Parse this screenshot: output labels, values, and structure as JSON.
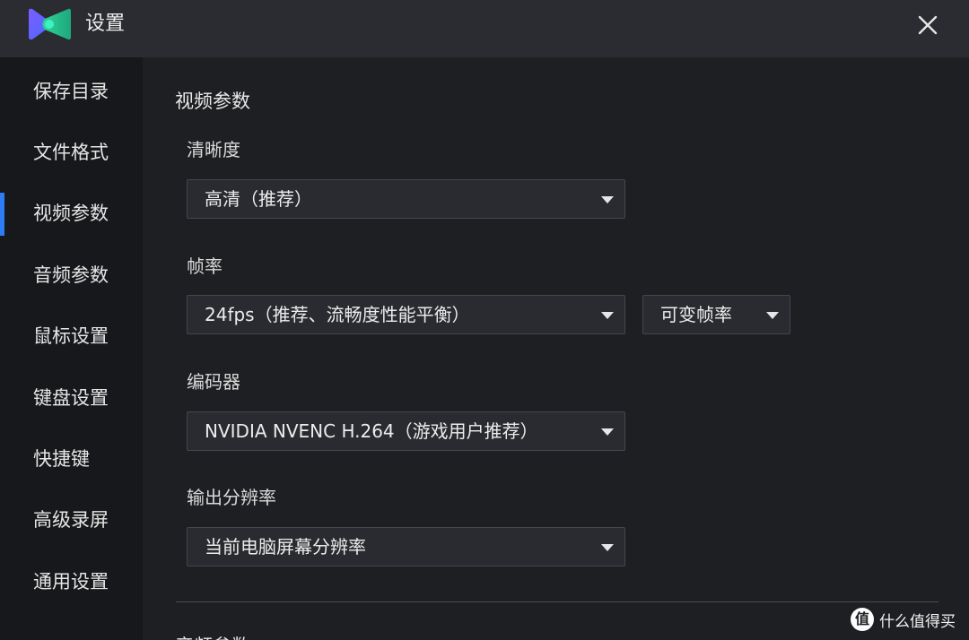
{
  "window": {
    "title": "设置",
    "close_icon": "close-icon"
  },
  "sidebar": {
    "items": [
      {
        "label": "保存目录",
        "active": false
      },
      {
        "label": "文件格式",
        "active": false
      },
      {
        "label": "视频参数",
        "active": true
      },
      {
        "label": "音频参数",
        "active": false
      },
      {
        "label": "鼠标设置",
        "active": false
      },
      {
        "label": "键盘设置",
        "active": false
      },
      {
        "label": "快捷键",
        "active": false
      },
      {
        "label": "高级录屏",
        "active": false
      },
      {
        "label": "通用设置",
        "active": false
      }
    ],
    "accent_color": "#2d7df6"
  },
  "main": {
    "section_title": "视频参数",
    "clarity": {
      "label": "清晰度",
      "value": "高清（推荐）"
    },
    "framerate": {
      "label": "帧率",
      "value": "24fps（推荐、流畅度性能平衡）",
      "mode_value": "可变帧率"
    },
    "encoder": {
      "label": "编码器",
      "value": "NVIDIA NVENC H.264（游戏用户推荐）"
    },
    "resolution": {
      "label": "输出分辨率",
      "value": "当前电脑屏幕分辨率"
    },
    "next_section_partial": "音频参数"
  },
  "watermark": {
    "badge": "值",
    "text": "什么值得买"
  }
}
